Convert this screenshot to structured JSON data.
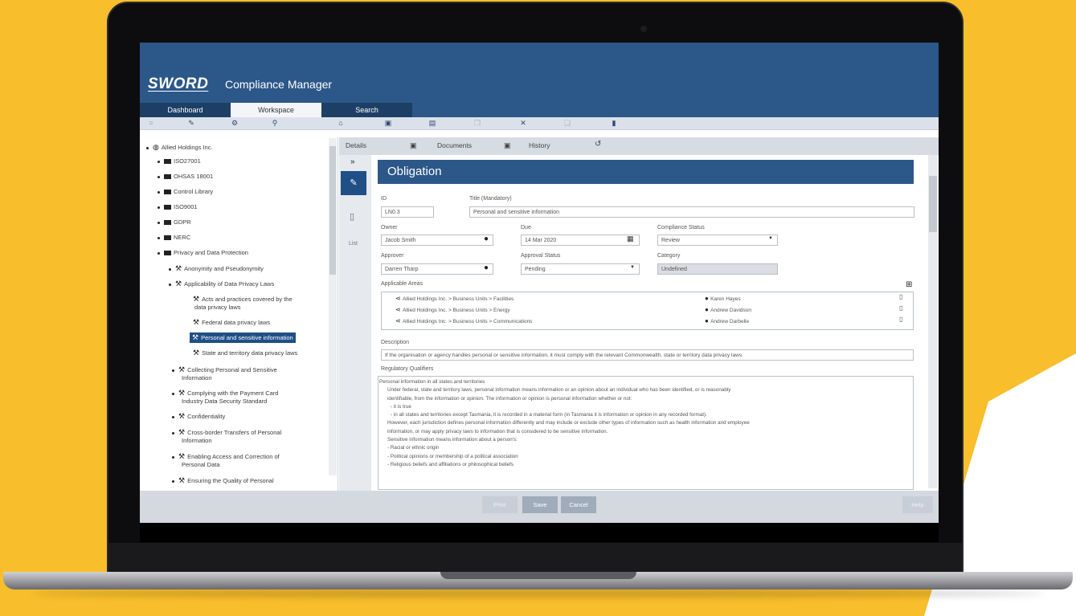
{
  "app": {
    "brand": "SWORD",
    "title": "Compliance Manager"
  },
  "nav_tabs": [
    "Dashboard",
    "Workspace",
    "Search"
  ],
  "tree": {
    "root": "Allied Holdings Inc.",
    "folders": [
      "ISO27001",
      "OHSAS 18001",
      "Control Library",
      "ISO9001",
      "GDPR",
      "NERC",
      "Privacy and Data Protection"
    ],
    "items": [
      "Anonymity and Pseudonymity",
      "Applicability of Data Privacy Laws",
      "Acts and practices covered by the",
      "data privacy laws",
      "Federal data privacy laws",
      "Personal and sensitive information",
      "State and territory data privacy laws",
      "Collecting Personal and Sensitive",
      "Information",
      "Complying with the Payment Card",
      "Industry Data Security Standard",
      "Confidentiality",
      "Cross-border Transfers of Personal",
      "Information",
      "Enabling Access and Correction of",
      "Personal Data",
      "Ensuring the Quality of Personal"
    ]
  },
  "panel_tabs": {
    "details": "Details",
    "documents": "Documents",
    "history": "History"
  },
  "side_labels": {
    "collapse": "»",
    "list": "List"
  },
  "form": {
    "header": "Obligation",
    "id_label": "ID",
    "id_value": "LN0.3",
    "title_label": "Title (Mandatory)",
    "title_value": "Personal and sensitive information",
    "owner_label": "Owner",
    "owner_value": "Jacob Smith",
    "due_label": "Due",
    "due_value": "14 Mar 2020",
    "compliance_label": "Compliance Status",
    "compliance_value": "Review",
    "approver_label": "Approver",
    "approver_value": "Darren Tharp",
    "approval_label": "Approval Status",
    "approval_value": "Pending",
    "category_label": "Category",
    "category_value": "Undefined",
    "areas_label": "Applicable Areas",
    "areas": [
      {
        "path": "Allied Holdings Inc. > Business Units > Facilities",
        "person": "Karen Hayes"
      },
      {
        "path": "Allied Holdings Inc. > Business Units > Energy",
        "person": "Andrew Davidson"
      },
      {
        "path": "Allied Holdings Inc. > Business Units > Communications",
        "person": "Andrew Darbelle"
      }
    ],
    "description_label": "Description",
    "description_value": "If the organisation or agency handles personal or sensitive information, it must comply with the relevant Commonwealth, state or territory data privacy laws.",
    "qualifiers_label": "Regulatory Qualifiers",
    "qualifier_lines": [
      "Personal information in all states and territories",
      "Under federal, state and territory laws, personal information means information or an opinion about an individual who has been identified, or is reasonably",
      "identifiable, from the information or opinion. The information or opinion is personal information whether or not:",
      "- it is true",
      "- in all states and territories except Tasmania, it is recorded in a material form (in Tasmania it is information or opinion in any recorded format).",
      "However, each jurisdiction defines personal information differently and may include or exclude other types of information such as health information and employee",
      "information, or may apply privacy laws to information that is considered to be sensitive information.",
      "Sensitive information means information about a person's:",
      "- Racial or ethnic origin",
      "- Political opinions or membership of a political association",
      "- Religious beliefs and affiliations or philosophical beliefs"
    ]
  },
  "buttons": {
    "print": "Print",
    "save": "Save",
    "cancel": "Cancel",
    "help": "Help"
  }
}
